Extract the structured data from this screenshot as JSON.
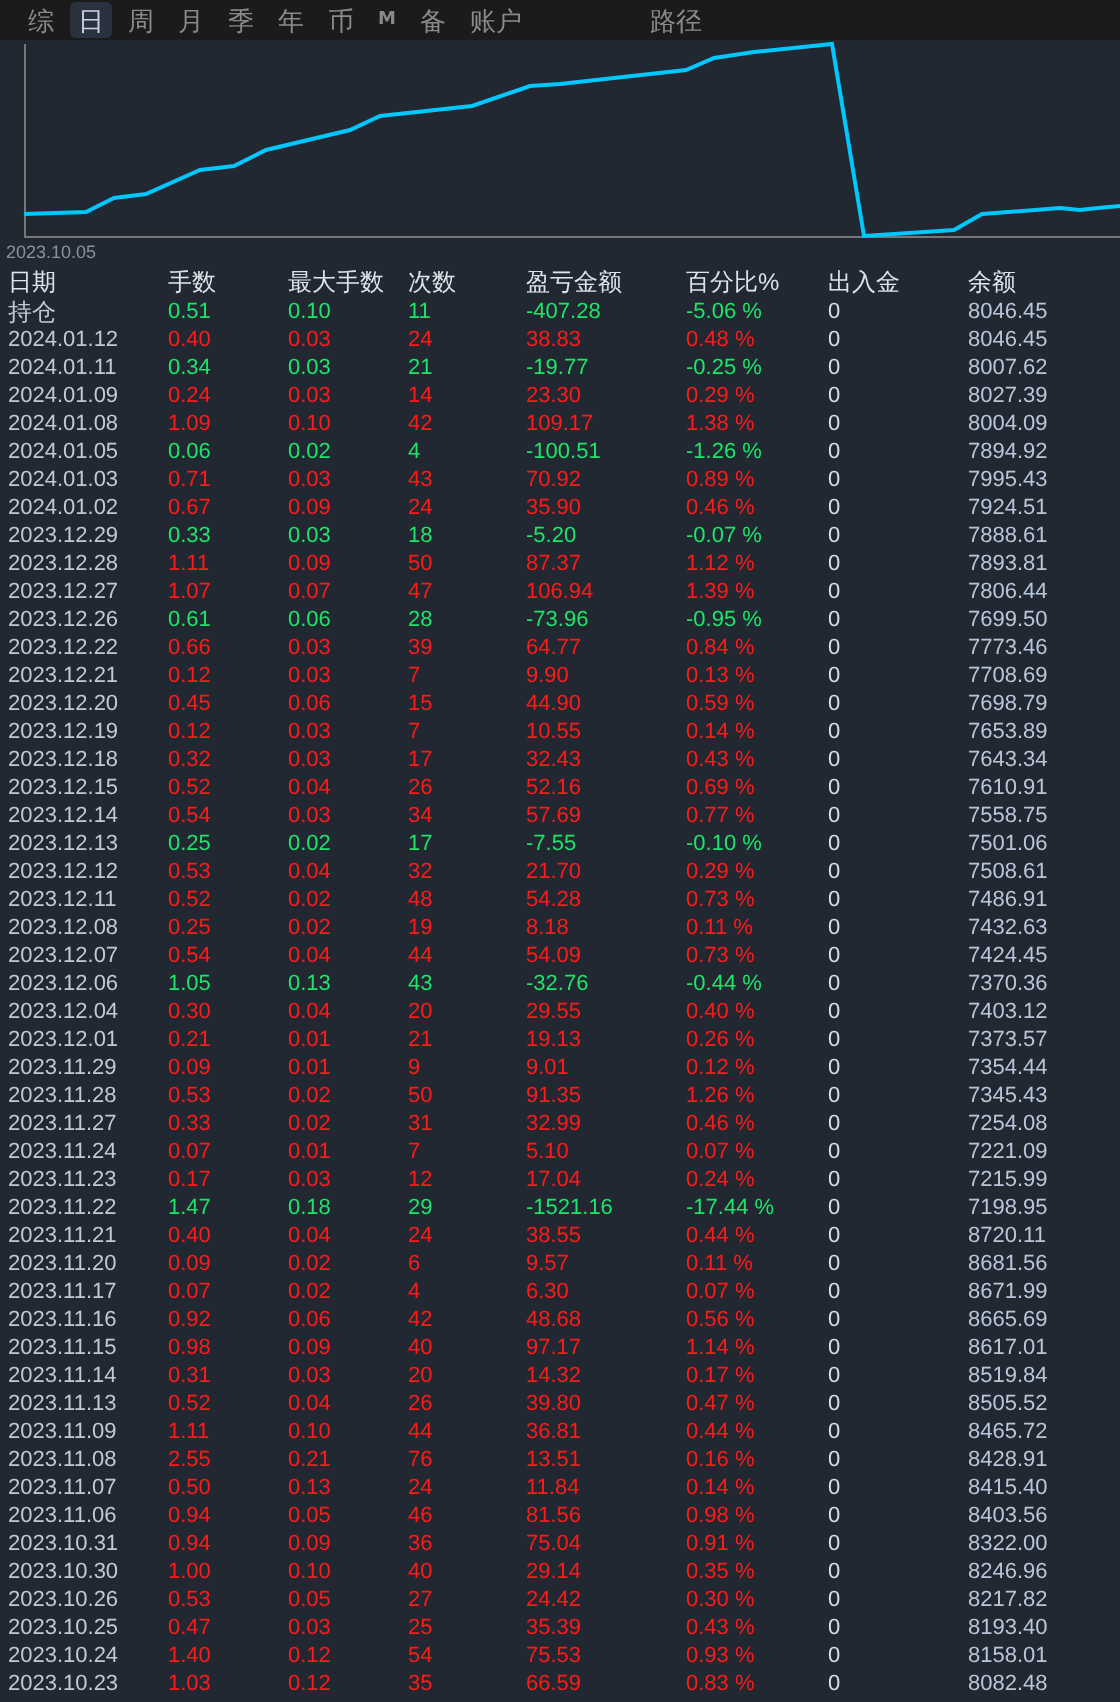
{
  "tabs": [
    {
      "label": "综",
      "selected": false
    },
    {
      "label": "日",
      "selected": true
    },
    {
      "label": "周",
      "selected": false
    },
    {
      "label": "月",
      "selected": false
    },
    {
      "label": "季",
      "selected": false
    },
    {
      "label": "年",
      "selected": false
    },
    {
      "label": "币",
      "selected": false
    },
    {
      "label": "M",
      "selected": false
    },
    {
      "label": "备",
      "selected": false
    },
    {
      "label": "账户",
      "selected": false
    }
  ],
  "path_tab": {
    "label": "路径",
    "selected": false
  },
  "chart": {
    "start_label": "2023.10.05"
  },
  "table": {
    "columns": [
      "日期",
      "手数",
      "最大手数",
      "次数",
      "盈亏金额",
      "百分比%",
      "出入金",
      "余额"
    ],
    "rows": [
      {
        "date": "持仓",
        "kind": "loss",
        "lots": "0.51",
        "max_lots": "0.10",
        "count": "11",
        "pnl": "-407.28",
        "percent": "-5.06 %",
        "deposit": "0",
        "balance": "8046.45"
      },
      {
        "date": "2024.01.12",
        "kind": "gain",
        "lots": "0.40",
        "max_lots": "0.03",
        "count": "24",
        "pnl": "38.83",
        "percent": "0.48 %",
        "deposit": "0",
        "balance": "8046.45"
      },
      {
        "date": "2024.01.11",
        "kind": "loss",
        "lots": "0.34",
        "max_lots": "0.03",
        "count": "21",
        "pnl": "-19.77",
        "percent": "-0.25 %",
        "deposit": "0",
        "balance": "8007.62"
      },
      {
        "date": "2024.01.09",
        "kind": "gain",
        "lots": "0.24",
        "max_lots": "0.03",
        "count": "14",
        "pnl": "23.30",
        "percent": "0.29 %",
        "deposit": "0",
        "balance": "8027.39"
      },
      {
        "date": "2024.01.08",
        "kind": "gain",
        "lots": "1.09",
        "max_lots": "0.10",
        "count": "42",
        "pnl": "109.17",
        "percent": "1.38 %",
        "deposit": "0",
        "balance": "8004.09"
      },
      {
        "date": "2024.01.05",
        "kind": "loss",
        "lots": "0.06",
        "max_lots": "0.02",
        "count": "4",
        "pnl": "-100.51",
        "percent": "-1.26 %",
        "deposit": "0",
        "balance": "7894.92"
      },
      {
        "date": "2024.01.03",
        "kind": "gain",
        "lots": "0.71",
        "max_lots": "0.03",
        "count": "43",
        "pnl": "70.92",
        "percent": "0.89 %",
        "deposit": "0",
        "balance": "7995.43"
      },
      {
        "date": "2024.01.02",
        "kind": "gain",
        "lots": "0.67",
        "max_lots": "0.09",
        "count": "24",
        "pnl": "35.90",
        "percent": "0.46 %",
        "deposit": "0",
        "balance": "7924.51"
      },
      {
        "date": "2023.12.29",
        "kind": "loss",
        "lots": "0.33",
        "max_lots": "0.03",
        "count": "18",
        "pnl": "-5.20",
        "percent": "-0.07 %",
        "deposit": "0",
        "balance": "7888.61"
      },
      {
        "date": "2023.12.28",
        "kind": "gain",
        "lots": "1.11",
        "max_lots": "0.09",
        "count": "50",
        "pnl": "87.37",
        "percent": "1.12 %",
        "deposit": "0",
        "balance": "7893.81"
      },
      {
        "date": "2023.12.27",
        "kind": "gain",
        "lots": "1.07",
        "max_lots": "0.07",
        "count": "47",
        "pnl": "106.94",
        "percent": "1.39 %",
        "deposit": "0",
        "balance": "7806.44"
      },
      {
        "date": "2023.12.26",
        "kind": "loss",
        "lots": "0.61",
        "max_lots": "0.06",
        "count": "28",
        "pnl": "-73.96",
        "percent": "-0.95 %",
        "deposit": "0",
        "balance": "7699.50"
      },
      {
        "date": "2023.12.22",
        "kind": "gain",
        "lots": "0.66",
        "max_lots": "0.03",
        "count": "39",
        "pnl": "64.77",
        "percent": "0.84 %",
        "deposit": "0",
        "balance": "7773.46"
      },
      {
        "date": "2023.12.21",
        "kind": "gain",
        "lots": "0.12",
        "max_lots": "0.03",
        "count": "7",
        "pnl": "9.90",
        "percent": "0.13 %",
        "deposit": "0",
        "balance": "7708.69"
      },
      {
        "date": "2023.12.20",
        "kind": "gain",
        "lots": "0.45",
        "max_lots": "0.06",
        "count": "15",
        "pnl": "44.90",
        "percent": "0.59 %",
        "deposit": "0",
        "balance": "7698.79"
      },
      {
        "date": "2023.12.19",
        "kind": "gain",
        "lots": "0.12",
        "max_lots": "0.03",
        "count": "7",
        "pnl": "10.55",
        "percent": "0.14 %",
        "deposit": "0",
        "balance": "7653.89"
      },
      {
        "date": "2023.12.18",
        "kind": "gain",
        "lots": "0.32",
        "max_lots": "0.03",
        "count": "17",
        "pnl": "32.43",
        "percent": "0.43 %",
        "deposit": "0",
        "balance": "7643.34"
      },
      {
        "date": "2023.12.15",
        "kind": "gain",
        "lots": "0.52",
        "max_lots": "0.04",
        "count": "26",
        "pnl": "52.16",
        "percent": "0.69 %",
        "deposit": "0",
        "balance": "7610.91"
      },
      {
        "date": "2023.12.14",
        "kind": "gain",
        "lots": "0.54",
        "max_lots": "0.03",
        "count": "34",
        "pnl": "57.69",
        "percent": "0.77 %",
        "deposit": "0",
        "balance": "7558.75"
      },
      {
        "date": "2023.12.13",
        "kind": "loss",
        "lots": "0.25",
        "max_lots": "0.02",
        "count": "17",
        "pnl": "-7.55",
        "percent": "-0.10 %",
        "deposit": "0",
        "balance": "7501.06"
      },
      {
        "date": "2023.12.12",
        "kind": "gain",
        "lots": "0.53",
        "max_lots": "0.04",
        "count": "32",
        "pnl": "21.70",
        "percent": "0.29 %",
        "deposit": "0",
        "balance": "7508.61"
      },
      {
        "date": "2023.12.11",
        "kind": "gain",
        "lots": "0.52",
        "max_lots": "0.02",
        "count": "48",
        "pnl": "54.28",
        "percent": "0.73 %",
        "deposit": "0",
        "balance": "7486.91"
      },
      {
        "date": "2023.12.08",
        "kind": "gain",
        "lots": "0.25",
        "max_lots": "0.02",
        "count": "19",
        "pnl": "8.18",
        "percent": "0.11 %",
        "deposit": "0",
        "balance": "7432.63"
      },
      {
        "date": "2023.12.07",
        "kind": "gain",
        "lots": "0.54",
        "max_lots": "0.04",
        "count": "44",
        "pnl": "54.09",
        "percent": "0.73 %",
        "deposit": "0",
        "balance": "7424.45"
      },
      {
        "date": "2023.12.06",
        "kind": "loss",
        "lots": "1.05",
        "max_lots": "0.13",
        "count": "43",
        "pnl": "-32.76",
        "percent": "-0.44 %",
        "deposit": "0",
        "balance": "7370.36"
      },
      {
        "date": "2023.12.04",
        "kind": "gain",
        "lots": "0.30",
        "max_lots": "0.04",
        "count": "20",
        "pnl": "29.55",
        "percent": "0.40 %",
        "deposit": "0",
        "balance": "7403.12"
      },
      {
        "date": "2023.12.01",
        "kind": "gain",
        "lots": "0.21",
        "max_lots": "0.01",
        "count": "21",
        "pnl": "19.13",
        "percent": "0.26 %",
        "deposit": "0",
        "balance": "7373.57"
      },
      {
        "date": "2023.11.29",
        "kind": "gain",
        "lots": "0.09",
        "max_lots": "0.01",
        "count": "9",
        "pnl": "9.01",
        "percent": "0.12 %",
        "deposit": "0",
        "balance": "7354.44"
      },
      {
        "date": "2023.11.28",
        "kind": "gain",
        "lots": "0.53",
        "max_lots": "0.02",
        "count": "50",
        "pnl": "91.35",
        "percent": "1.26 %",
        "deposit": "0",
        "balance": "7345.43"
      },
      {
        "date": "2023.11.27",
        "kind": "gain",
        "lots": "0.33",
        "max_lots": "0.02",
        "count": "31",
        "pnl": "32.99",
        "percent": "0.46 %",
        "deposit": "0",
        "balance": "7254.08"
      },
      {
        "date": "2023.11.24",
        "kind": "gain",
        "lots": "0.07",
        "max_lots": "0.01",
        "count": "7",
        "pnl": "5.10",
        "percent": "0.07 %",
        "deposit": "0",
        "balance": "7221.09"
      },
      {
        "date": "2023.11.23",
        "kind": "gain",
        "lots": "0.17",
        "max_lots": "0.03",
        "count": "12",
        "pnl": "17.04",
        "percent": "0.24 %",
        "deposit": "0",
        "balance": "7215.99"
      },
      {
        "date": "2023.11.22",
        "kind": "loss",
        "lots": "1.47",
        "max_lots": "0.18",
        "count": "29",
        "pnl": "-1521.16",
        "percent": "-17.44 %",
        "deposit": "0",
        "balance": "7198.95"
      },
      {
        "date": "2023.11.21",
        "kind": "gain",
        "lots": "0.40",
        "max_lots": "0.04",
        "count": "24",
        "pnl": "38.55",
        "percent": "0.44 %",
        "deposit": "0",
        "balance": "8720.11"
      },
      {
        "date": "2023.11.20",
        "kind": "gain",
        "lots": "0.09",
        "max_lots": "0.02",
        "count": "6",
        "pnl": "9.57",
        "percent": "0.11 %",
        "deposit": "0",
        "balance": "8681.56"
      },
      {
        "date": "2023.11.17",
        "kind": "gain",
        "lots": "0.07",
        "max_lots": "0.02",
        "count": "4",
        "pnl": "6.30",
        "percent": "0.07 %",
        "deposit": "0",
        "balance": "8671.99"
      },
      {
        "date": "2023.11.16",
        "kind": "gain",
        "lots": "0.92",
        "max_lots": "0.06",
        "count": "42",
        "pnl": "48.68",
        "percent": "0.56 %",
        "deposit": "0",
        "balance": "8665.69"
      },
      {
        "date": "2023.11.15",
        "kind": "gain",
        "lots": "0.98",
        "max_lots": "0.09",
        "count": "40",
        "pnl": "97.17",
        "percent": "1.14 %",
        "deposit": "0",
        "balance": "8617.01"
      },
      {
        "date": "2023.11.14",
        "kind": "gain",
        "lots": "0.31",
        "max_lots": "0.03",
        "count": "20",
        "pnl": "14.32",
        "percent": "0.17 %",
        "deposit": "0",
        "balance": "8519.84"
      },
      {
        "date": "2023.11.13",
        "kind": "gain",
        "lots": "0.52",
        "max_lots": "0.04",
        "count": "26",
        "pnl": "39.80",
        "percent": "0.47 %",
        "deposit": "0",
        "balance": "8505.52"
      },
      {
        "date": "2023.11.09",
        "kind": "gain",
        "lots": "1.11",
        "max_lots": "0.10",
        "count": "44",
        "pnl": "36.81",
        "percent": "0.44 %",
        "deposit": "0",
        "balance": "8465.72"
      },
      {
        "date": "2023.11.08",
        "kind": "gain",
        "lots": "2.55",
        "max_lots": "0.21",
        "count": "76",
        "pnl": "13.51",
        "percent": "0.16 %",
        "deposit": "0",
        "balance": "8428.91"
      },
      {
        "date": "2023.11.07",
        "kind": "gain",
        "lots": "0.50",
        "max_lots": "0.13",
        "count": "24",
        "pnl": "11.84",
        "percent": "0.14 %",
        "deposit": "0",
        "balance": "8415.40"
      },
      {
        "date": "2023.11.06",
        "kind": "gain",
        "lots": "0.94",
        "max_lots": "0.05",
        "count": "46",
        "pnl": "81.56",
        "percent": "0.98 %",
        "deposit": "0",
        "balance": "8403.56"
      },
      {
        "date": "2023.10.31",
        "kind": "gain",
        "lots": "0.94",
        "max_lots": "0.09",
        "count": "36",
        "pnl": "75.04",
        "percent": "0.91 %",
        "deposit": "0",
        "balance": "8322.00"
      },
      {
        "date": "2023.10.30",
        "kind": "gain",
        "lots": "1.00",
        "max_lots": "0.10",
        "count": "40",
        "pnl": "29.14",
        "percent": "0.35 %",
        "deposit": "0",
        "balance": "8246.96"
      },
      {
        "date": "2023.10.26",
        "kind": "gain",
        "lots": "0.53",
        "max_lots": "0.05",
        "count": "27",
        "pnl": "24.42",
        "percent": "0.30 %",
        "deposit": "0",
        "balance": "8217.82"
      },
      {
        "date": "2023.10.25",
        "kind": "gain",
        "lots": "0.47",
        "max_lots": "0.03",
        "count": "25",
        "pnl": "35.39",
        "percent": "0.43 %",
        "deposit": "0",
        "balance": "8193.40"
      },
      {
        "date": "2023.10.24",
        "kind": "gain",
        "lots": "1.40",
        "max_lots": "0.12",
        "count": "54",
        "pnl": "75.53",
        "percent": "0.93 %",
        "deposit": "0",
        "balance": "8158.01"
      },
      {
        "date": "2023.10.23",
        "kind": "gain",
        "lots": "1.03",
        "max_lots": "0.12",
        "count": "35",
        "pnl": "66.59",
        "percent": "0.83 %",
        "deposit": "0",
        "balance": "8082.48"
      }
    ]
  }
}
